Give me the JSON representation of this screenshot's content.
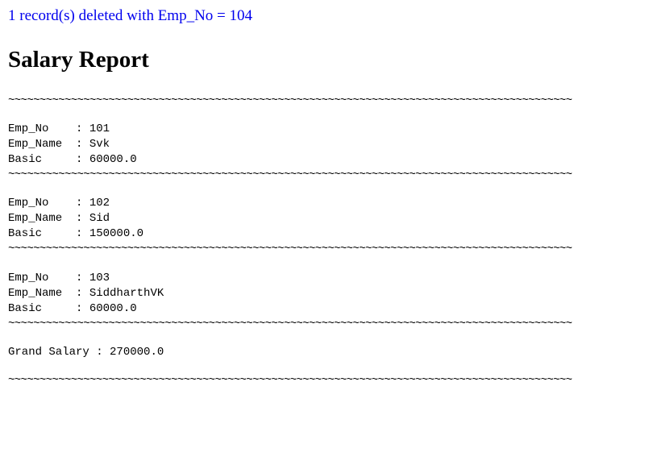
{
  "status_message": "1 record(s) deleted with Emp_No = 104",
  "status_color": "#0000ee",
  "report_title": "Salary Report",
  "separator": "~~~~~~~~~~~~~~~~~~~~~~~~~~~~~~~~~~~~~~~~~~~~~~~~~~~~~~~~~~~~~~~~~~~~~~~~~~~~~~~~~~~~~~~~~~",
  "labels": {
    "emp_no": "Emp_No    : ",
    "emp_name": "Emp_Name  : ",
    "basic": "Basic     : "
  },
  "records": [
    {
      "emp_no": "101",
      "emp_name": "Svk",
      "basic": "60000.0"
    },
    {
      "emp_no": "102",
      "emp_name": "Sid",
      "basic": "150000.0"
    },
    {
      "emp_no": "103",
      "emp_name": "SiddharthVK",
      "basic": "60000.0"
    }
  ],
  "grand_total": {
    "label": "Grand Salary : ",
    "value": "270000.0"
  }
}
